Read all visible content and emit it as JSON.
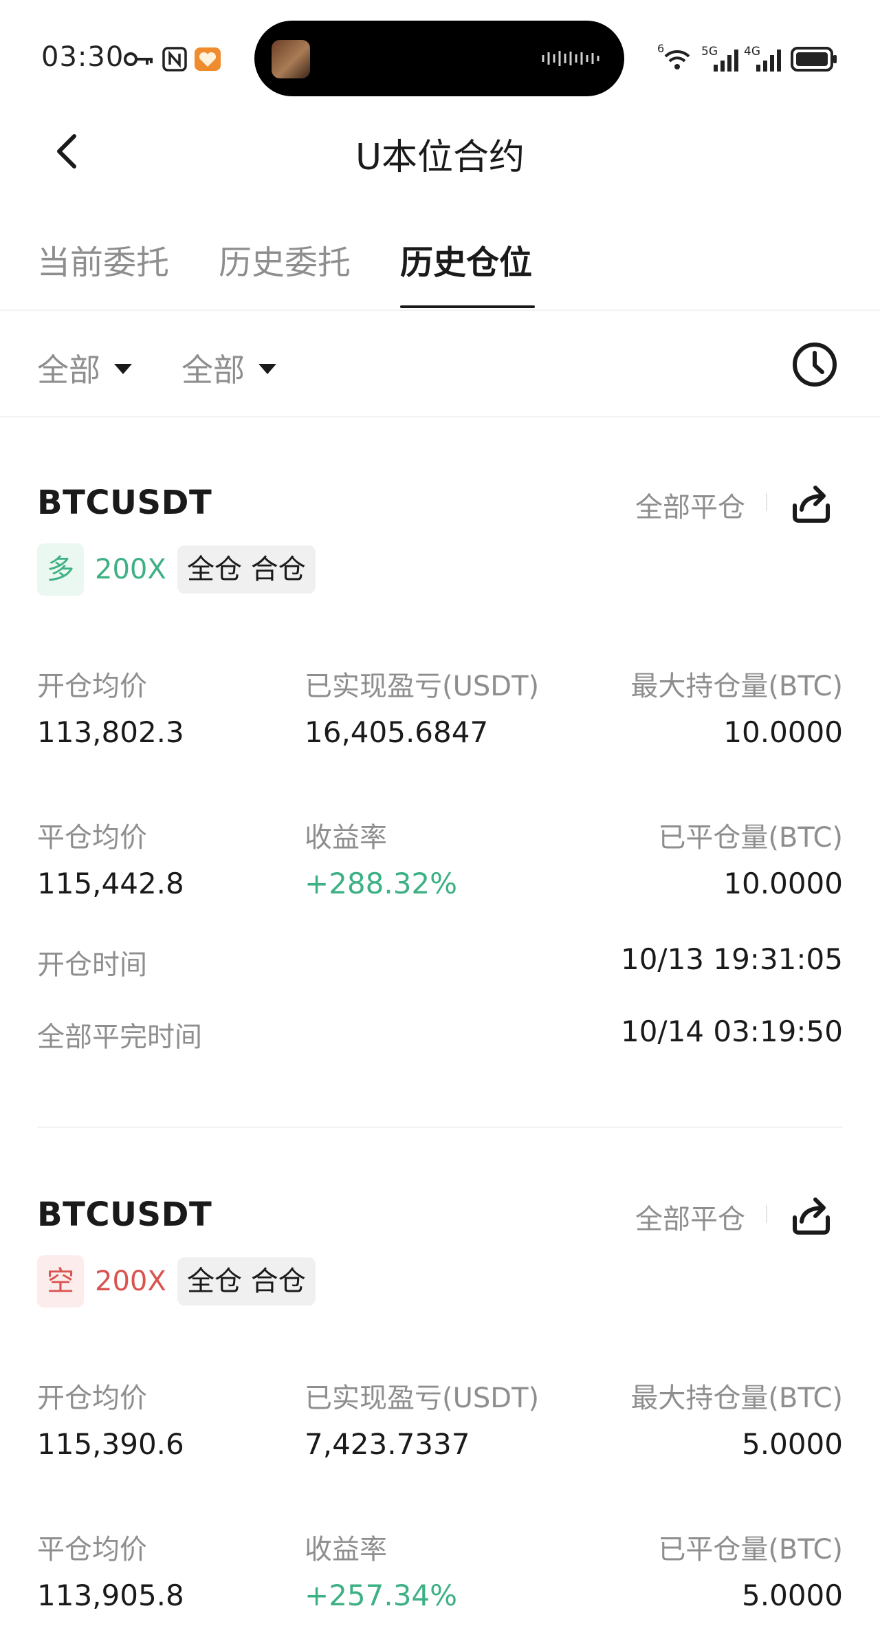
{
  "status_bar": {
    "time": "03:30",
    "icons": [
      "key-icon",
      "nfc-icon",
      "heart-app-icon",
      "wifi-icon",
      "signal-5g-icon",
      "signal-4g-icon",
      "battery-icon"
    ],
    "signal_labels": {
      "wifi": "6",
      "sim1": "5G",
      "sim2": "4G"
    }
  },
  "header": {
    "title": "U本位合约"
  },
  "tabs": [
    {
      "label": "当前委托",
      "active": false
    },
    {
      "label": "历史委托",
      "active": false
    },
    {
      "label": "历史仓位",
      "active": true
    }
  ],
  "filters": [
    {
      "label": "全部"
    },
    {
      "label": "全部"
    }
  ],
  "positions": [
    {
      "symbol": "BTCUSDT",
      "close_all_label": "全部平仓",
      "side": "多",
      "side_type": "long",
      "leverage": "200X",
      "margin_mode": "全仓 合仓",
      "open_avg_label": "开仓均价",
      "open_avg": "113,802.3",
      "realized_pnl_label": "已实现盈亏(USDT)",
      "realized_pnl": "16,405.6847",
      "max_pos_label": "最大持仓量(BTC)",
      "max_pos": "10.0000",
      "close_avg_label": "平仓均价",
      "close_avg": "115,442.8",
      "roi_label": "收益率",
      "roi": "+288.32%",
      "closed_qty_label": "已平仓量(BTC)",
      "closed_qty": "10.0000",
      "open_time_label": "开仓时间",
      "open_time": "10/13 19:31:05",
      "close_time_label": "全部平完时间",
      "close_time": "10/14 03:19:50"
    },
    {
      "symbol": "BTCUSDT",
      "close_all_label": "全部平仓",
      "side": "空",
      "side_type": "short",
      "leverage": "200X",
      "margin_mode": "全仓 合仓",
      "open_avg_label": "开仓均价",
      "open_avg": "115,390.6",
      "realized_pnl_label": "已实现盈亏(USDT)",
      "realized_pnl": "7,423.7337",
      "max_pos_label": "最大持仓量(BTC)",
      "max_pos": "5.0000",
      "close_avg_label": "平仓均价",
      "close_avg": "113,905.8",
      "roi_label": "收益率",
      "roi": "+257.34%",
      "closed_qty_label": "已平仓量(BTC)",
      "closed_qty": "5.0000"
    }
  ],
  "colors": {
    "long": "#3eb184",
    "short": "#d9534f",
    "text_primary": "#1a1a1a",
    "text_secondary": "#8e8e8e"
  }
}
